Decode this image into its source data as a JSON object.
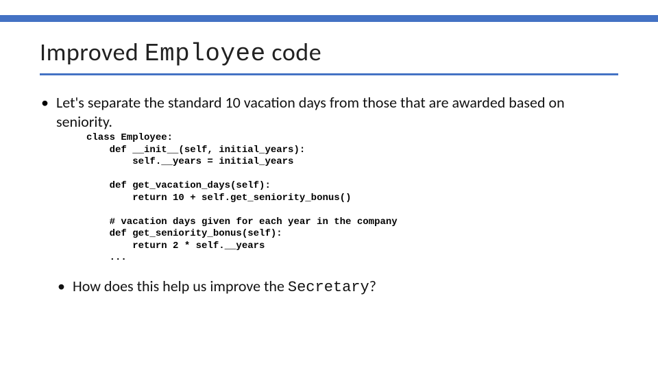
{
  "title": {
    "part1": "Improved ",
    "part2_mono": "Employee",
    "part3": " code"
  },
  "bullet1": "Let's separate the standard 10 vacation days from those that are awarded based on seniority.",
  "code": {
    "l1": "class Employee:",
    "l2": "    def __init__(self, initial_years):",
    "l3": "        self.__years = initial_years",
    "l4": "",
    "l5": "    def get_vacation_days(self):",
    "l6a": "        return 10 + self.",
    "l6b": "get_seniority_bonus()",
    "l7": "",
    "l8": "    # vacation days given for each year in the company",
    "l9": "    def get_seniority_bonus(self):",
    "l10": "        return 2 * self.__years",
    "l11": "    ..."
  },
  "bullet2": {
    "pre": "How does this help us improve the ",
    "mono": "Secretary",
    "post": "?"
  }
}
